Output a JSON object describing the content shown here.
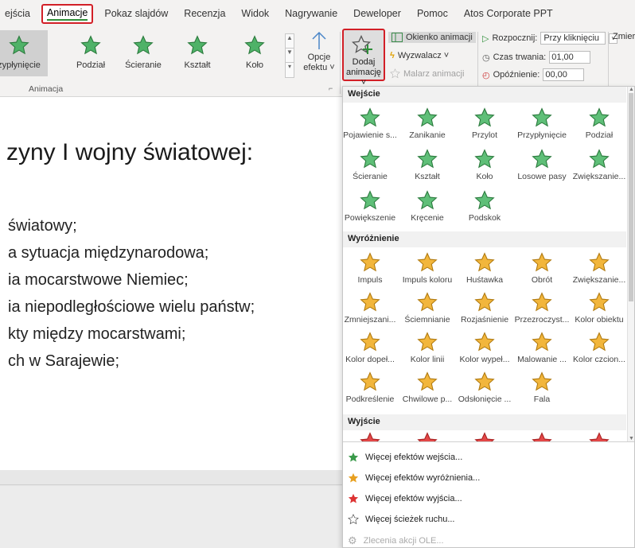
{
  "ribbon": {
    "tabs": [
      "ejścia",
      "Animacje",
      "Pokaz slajdów",
      "Recenzja",
      "Widok",
      "Nagrywanie",
      "Deweloper",
      "Pomoc",
      "Atos Corporate PPT"
    ],
    "active_tab": "Animacje",
    "gallery": [
      "zypłynięcie",
      "Podział",
      "Ścieranie",
      "Kształt",
      "Koło"
    ],
    "options_label_line1": "Opcje",
    "options_label_line2": "efektu ˅",
    "group_animation_label": "Animacja",
    "add_animation_line1": "Dodaj",
    "add_animation_line2": "animację ˅",
    "animation_pane": "Okienko animacji",
    "trigger": "Wyzwalacz ˅",
    "painter": "Malarz animacji",
    "start_label": "Rozpocznij:",
    "start_value": "Przy kliknięciu",
    "duration_label": "Czas trwania:",
    "duration_value": "01,00",
    "delay_label": "Opóźnienie:",
    "delay_value": "00,00",
    "right_cut": "Zmier"
  },
  "slide": {
    "title": "zyny I wojny światowej:",
    "bullets": [
      "światowy;",
      "a sytuacja międzynarodowa;",
      "ia mocarstwowe Niemiec;",
      "ia niepodległościowe wielu państw;",
      "kty między mocarstwami;",
      "ch w Sarajewie;"
    ]
  },
  "panel": {
    "entrance_header": "Wejście",
    "entrance": [
      "Pojawienie s...",
      "Zanikanie",
      "Przylot",
      "Przypłynięcie",
      "Podział",
      "Ścieranie",
      "Kształt",
      "Koło",
      "Losowe pasy",
      "Zwiększanie...",
      "Powiększenie",
      "Kręcenie",
      "Podskok"
    ],
    "emphasis_header": "Wyróżnienie",
    "emphasis": [
      "Impuls",
      "Impuls koloru",
      "Huśtawka",
      "Obrót",
      "Zwiększanie...",
      "Zmniejszani...",
      "Ściemnianie",
      "Rozjaśnienie",
      "Przezroczyst...",
      "Kolor obiektu",
      "Kolor dopeł...",
      "Kolor linii",
      "Kolor wypeł...",
      "Malowanie ...",
      "Kolor czcion...",
      "Podkreślenie",
      "Chwilowe p...",
      "Odsłonięcie ...",
      "Fala"
    ],
    "exit_header": "Wyjście",
    "more": [
      {
        "label": "Więcej efektów wejścia...",
        "icon": "star-entrance-icon",
        "color": "#3a9a4a"
      },
      {
        "label": "Więcej efektów wyróżnienia...",
        "icon": "star-emphasis-icon",
        "color": "#e8a020"
      },
      {
        "label": "Więcej efektów wyjścia...",
        "icon": "star-exit-icon",
        "color": "#d33"
      },
      {
        "label": "Więcej ścieżek ruchu...",
        "icon": "star-outline-icon",
        "color": "#333"
      },
      {
        "label": "Zlecenia akcji OLE...",
        "icon": "ole-icon",
        "color": "#aaa"
      }
    ]
  },
  "colors": {
    "accent_green": "#2f8f3a",
    "highlight_red": "#d21f27",
    "star_green": "#3da35a",
    "star_gold": "#f2b63c"
  }
}
